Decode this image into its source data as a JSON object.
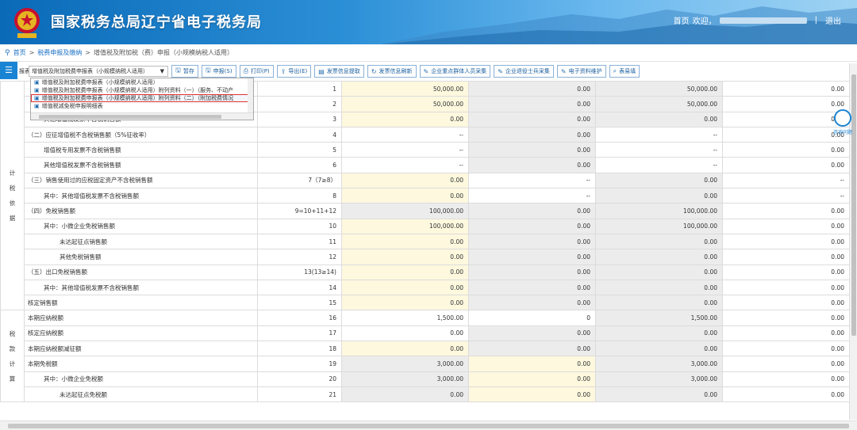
{
  "header": {
    "title": "国家税务总局辽宁省电子税务局",
    "nav_home": "首页",
    "nav_welcome": "欢迎，",
    "nav_sep": "|",
    "nav_logout": "退出"
  },
  "breadcrumb": {
    "items": [
      "首页",
      "税费申报及缴纳",
      "增值税及附加税（费）申报（小规模纳税人适用）"
    ]
  },
  "toolbar": {
    "report_label": "报表:",
    "report_select": "增值税及附加税费申报表（小规模纳税人适用）",
    "buttons": [
      {
        "icon": "save-icon",
        "label": "暂存"
      },
      {
        "icon": "submit-icon",
        "label": "申报(S)"
      },
      {
        "icon": "print-icon",
        "label": "打印(P)"
      },
      {
        "icon": "export-icon",
        "label": "导出(E)"
      },
      {
        "icon": "invoice-icon",
        "label": "发票信息提取"
      },
      {
        "icon": "refresh-icon",
        "label": "发票信息刷新"
      },
      {
        "icon": "edit-icon",
        "label": "企业重点群体人员采集"
      },
      {
        "icon": "edit-icon",
        "label": "企业退役士兵采集"
      },
      {
        "icon": "edit-icon",
        "label": "电子资料维护"
      },
      {
        "icon": "search-icon",
        "label": "表易填"
      }
    ]
  },
  "dropdown": {
    "items": [
      "增值税及附加税费申报表（小规模纳税人适用）",
      "增值税及附加税费申报表（小规模纳税人适用）附列资料（一）（服务、不动产",
      "增值税及附加税费申报表（小规模纳税人适用）附列资料（二）（附加税费情况",
      "增值税减免税申报明细表"
    ],
    "highlighted": 2
  },
  "help_float": {
    "label": "咨询问题"
  },
  "table": {
    "groups": [
      {
        "label": [
          "计",
          "税",
          "依",
          "据"
        ],
        "span": 15
      },
      {
        "label": [
          "税",
          "款",
          "计",
          "算"
        ],
        "span": 6
      }
    ],
    "rows": [
      {
        "item": "",
        "level": 0,
        "no": "1",
        "c1": "50,000.00",
        "c2": "0.00",
        "c3": "50,000.00",
        "c4": "0.00",
        "s1": "yellow",
        "s2": "gray",
        "s3": "gray",
        "s4": "white"
      },
      {
        "item": "",
        "level": 0,
        "no": "2",
        "c1": "50,000.00",
        "c2": "0.00",
        "c3": "50,000.00",
        "c4": "0.00",
        "s1": "yellow",
        "s2": "gray",
        "s3": "gray",
        "s4": "white"
      },
      {
        "item": "其他增值税发票不含税销售额",
        "level": 1,
        "no": "3",
        "c1": "0.00",
        "c2": "0.00",
        "c3": "0.00",
        "c4": "0.00",
        "s1": "yellow",
        "s2": "gray",
        "s3": "gray",
        "s4": "white"
      },
      {
        "item": "（二）应征增值税不含税销售额（5%征收率）",
        "level": 0,
        "no": "4",
        "c1": "--",
        "c2": "0.00",
        "c3": "--",
        "c4": "0.00",
        "s1": "white",
        "s2": "gray",
        "s3": "white",
        "s4": "white"
      },
      {
        "item": "增值税专用发票不含税销售额",
        "level": 1,
        "no": "5",
        "c1": "--",
        "c2": "0.00",
        "c3": "--",
        "c4": "0.00",
        "s1": "white",
        "s2": "gray",
        "s3": "white",
        "s4": "white"
      },
      {
        "item": "其他增值税发票不含税销售额",
        "level": 1,
        "no": "6",
        "c1": "--",
        "c2": "0.00",
        "c3": "--",
        "c4": "0.00",
        "s1": "white",
        "s2": "gray",
        "s3": "white",
        "s4": "white"
      },
      {
        "item": "（三）销售使用过的应税固定资产不含税销售额",
        "level": 0,
        "no": "7（7≥8）",
        "c1": "0.00",
        "c2": "--",
        "c3": "0.00",
        "c4": "--",
        "s1": "yellow",
        "s2": "white",
        "s3": "gray",
        "s4": "white"
      },
      {
        "item": "其中：其他增值税发票不含税销售额",
        "level": 1,
        "no": "8",
        "c1": "0.00",
        "c2": "--",
        "c3": "0.00",
        "c4": "--",
        "s1": "yellow",
        "s2": "white",
        "s3": "gray",
        "s4": "white"
      },
      {
        "item": "（四）免税销售额",
        "level": 0,
        "no": "9=10+11+12",
        "c1": "100,000.00",
        "c2": "0.00",
        "c3": "100,000.00",
        "c4": "0.00",
        "s1": "gray",
        "s2": "gray",
        "s3": "gray",
        "s4": "white"
      },
      {
        "item": "其中：小微企业免税销售额",
        "level": 1,
        "no": "10",
        "c1": "100,000.00",
        "c2": "0.00",
        "c3": "100,000.00",
        "c4": "0.00",
        "s1": "yellow",
        "s2": "gray",
        "s3": "gray",
        "s4": "white"
      },
      {
        "item": "未达起征点销售额",
        "level": 2,
        "no": "11",
        "c1": "0.00",
        "c2": "0.00",
        "c3": "0.00",
        "c4": "0.00",
        "s1": "yellow",
        "s2": "gray",
        "s3": "gray",
        "s4": "white"
      },
      {
        "item": "其他免税销售额",
        "level": 2,
        "no": "12",
        "c1": "0.00",
        "c2": "0.00",
        "c3": "0.00",
        "c4": "0.00",
        "s1": "yellow",
        "s2": "gray",
        "s3": "gray",
        "s4": "white"
      },
      {
        "item": "（五）出口免税销售额",
        "level": 0,
        "no": "13(13≥14)",
        "c1": "0.00",
        "c2": "0.00",
        "c3": "0.00",
        "c4": "0.00",
        "s1": "yellow",
        "s2": "gray",
        "s3": "gray",
        "s4": "white"
      },
      {
        "item": "其中：其他增值税发票不含税销售额",
        "level": 1,
        "no": "14",
        "c1": "0.00",
        "c2": "0.00",
        "c3": "0.00",
        "c4": "0.00",
        "s1": "yellow",
        "s2": "gray",
        "s3": "gray",
        "s4": "white"
      },
      {
        "item": "核定销售额",
        "level": 0,
        "no": "15",
        "c1": "0.00",
        "c2": "0.00",
        "c3": "0.00",
        "c4": "0.00",
        "s1": "yellow",
        "s2": "gray",
        "s3": "gray",
        "s4": "white"
      },
      {
        "item": "本期应纳税额",
        "level": 0,
        "no": "16",
        "c1": "1,500.00",
        "c2": "0",
        "c3": "1,500.00",
        "c4": "0.00",
        "s1": "white",
        "s2": "white",
        "s3": "gray",
        "s4": "white"
      },
      {
        "item": "核定应纳税额",
        "level": 0,
        "no": "17",
        "c1": "0.00",
        "c2": "0.00",
        "c3": "0.00",
        "c4": "0.00",
        "s1": "white",
        "s2": "gray",
        "s3": "gray",
        "s4": "white"
      },
      {
        "item": "本期应纳税额减征额",
        "level": 0,
        "no": "18",
        "c1": "0.00",
        "c2": "0.00",
        "c3": "0.00",
        "c4": "0.00",
        "s1": "yellow",
        "s2": "gray",
        "s3": "gray",
        "s4": "white"
      },
      {
        "item": "本期免税额",
        "level": 0,
        "no": "19",
        "c1": "3,000.00",
        "c2": "0.00",
        "c3": "3,000.00",
        "c4": "0.00",
        "s1": "gray",
        "s2": "yellow",
        "s3": "gray",
        "s4": "white"
      },
      {
        "item": "其中：小微企业免税额",
        "level": 1,
        "no": "20",
        "c1": "3,000.00",
        "c2": "0.00",
        "c3": "3,000.00",
        "c4": "0.00",
        "s1": "gray",
        "s2": "yellow",
        "s3": "gray",
        "s4": "white"
      },
      {
        "item": "未达起征点免税额",
        "level": 2,
        "no": "21",
        "c1": "0.00",
        "c2": "0.00",
        "c3": "0.00",
        "c4": "0.00",
        "s1": "gray",
        "s2": "yellow",
        "s3": "gray",
        "s4": "white"
      }
    ]
  }
}
